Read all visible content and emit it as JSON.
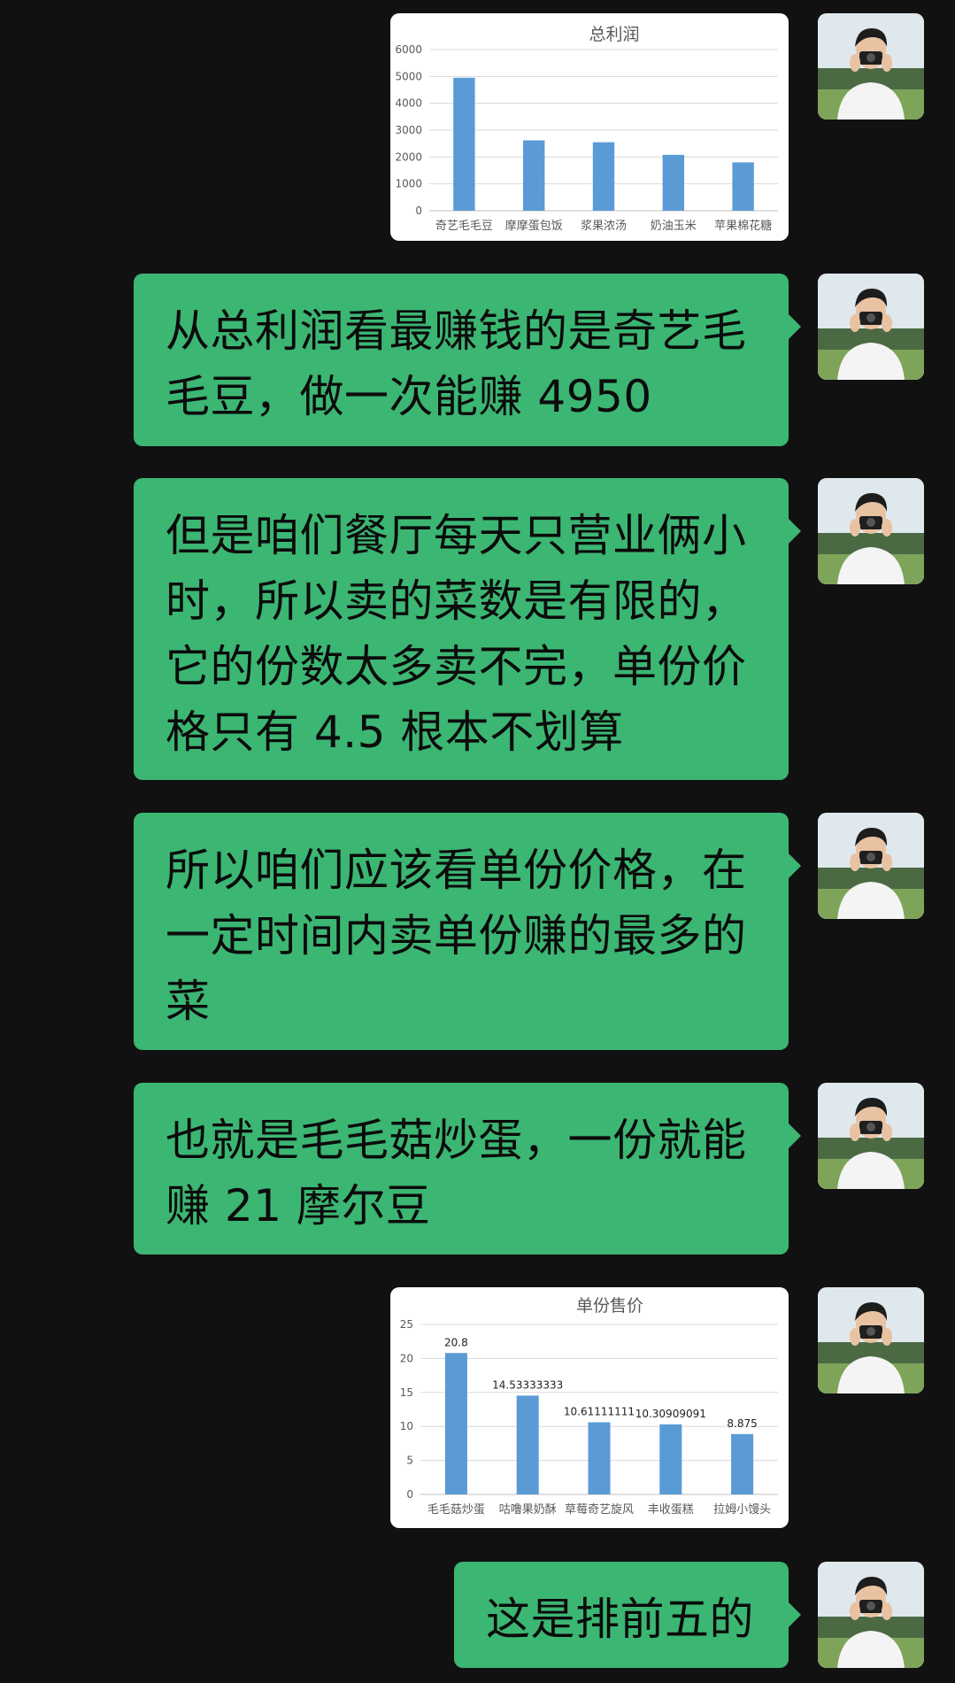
{
  "colors": {
    "background": "#111111",
    "bubble": "#3cb673",
    "bar": "#5b9bd5"
  },
  "messages": [
    {
      "type": "chart",
      "sender": "me"
    },
    {
      "type": "text",
      "sender": "me",
      "text": "从总利润看最赚钱的是奇艺毛毛豆，做一次能赚 4950"
    },
    {
      "type": "text",
      "sender": "me",
      "text": "但是咱们餐厅每天只营业俩小时，所以卖的菜数是有限的，它的份数太多卖不完，单份价格只有 4.5 根本不划算"
    },
    {
      "type": "text",
      "sender": "me",
      "text": "所以咱们应该看单份价格，在一定时间内卖单份赚的最多的菜"
    },
    {
      "type": "text",
      "sender": "me",
      "text": "也就是毛毛菇炒蛋，一份就能赚 21 摩尔豆"
    },
    {
      "type": "chart",
      "sender": "me"
    },
    {
      "type": "text",
      "sender": "me",
      "text": "这是排前五的"
    }
  ],
  "chart_data": [
    {
      "type": "bar",
      "title": "总利润",
      "categories": [
        "奇艺毛毛豆",
        "摩摩蛋包饭",
        "浆果浓汤",
        "奶油玉米",
        "苹果棉花糖"
      ],
      "values": [
        4950,
        2620,
        2550,
        2080,
        1800
      ],
      "ylim": [
        0,
        6000
      ],
      "yticks": [
        0,
        1000,
        2000,
        3000,
        4000,
        5000,
        6000
      ],
      "yticklabels": [
        "0",
        "1000",
        "2000",
        "3000",
        "4000",
        "5000",
        "6000"
      ],
      "grid": true,
      "data_labels": false
    },
    {
      "type": "bar",
      "title": "单份售价",
      "categories": [
        "毛毛菇炒蛋",
        "咕噜果奶酥",
        "草莓奇艺旋风",
        "丰收蛋糕",
        "拉姆小馒头"
      ],
      "values": [
        20.8,
        14.53333333,
        10.61111111,
        10.30909091,
        8.875
      ],
      "value_labels": [
        "20.8",
        "14.53333333",
        "10.61111111",
        "10.30909091",
        "8.875"
      ],
      "ylim": [
        0,
        25
      ],
      "yticks": [
        0,
        5,
        10,
        15,
        20,
        25
      ],
      "yticklabels": [
        "0",
        "5",
        "10",
        "15",
        "20",
        "25"
      ],
      "grid": true,
      "data_labels": true
    }
  ]
}
